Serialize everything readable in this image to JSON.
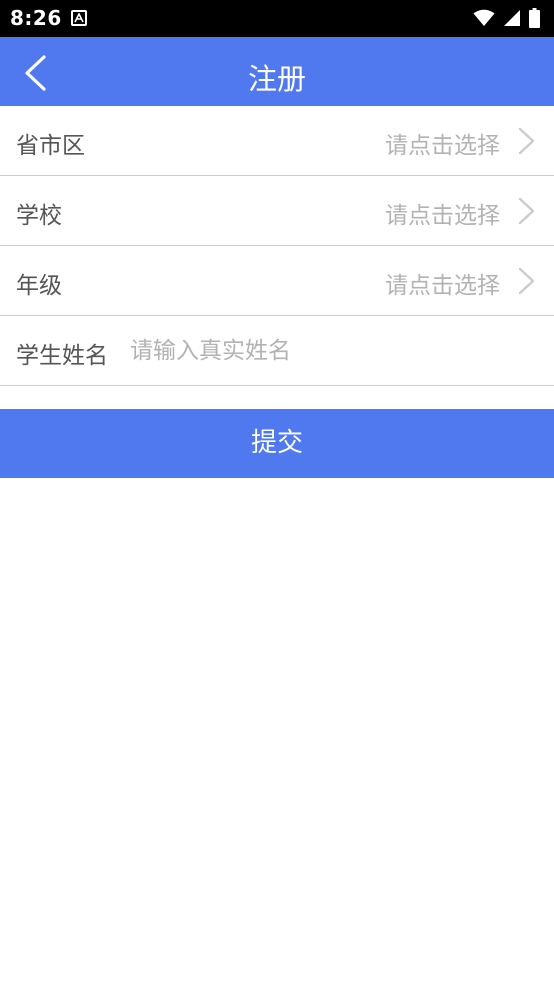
{
  "status_bar": {
    "time": "8:26",
    "notification_icon": "text-a-icon",
    "icons": [
      "wifi-icon",
      "cellular-signal-icon",
      "battery-icon"
    ]
  },
  "app_bar": {
    "title": "注册",
    "back_icon": "chevron-left-icon",
    "color": "#5079f0"
  },
  "form": {
    "region": {
      "label": "省市区",
      "value": "请点击选择"
    },
    "school": {
      "label": "学校",
      "value": "请点击选择"
    },
    "grade": {
      "label": "年级",
      "value": "请点击选择"
    },
    "student_name": {
      "label": "学生姓名",
      "placeholder": "请输入真实姓名",
      "value": ""
    }
  },
  "submit": {
    "label": "提交",
    "color": "#5079f0"
  }
}
